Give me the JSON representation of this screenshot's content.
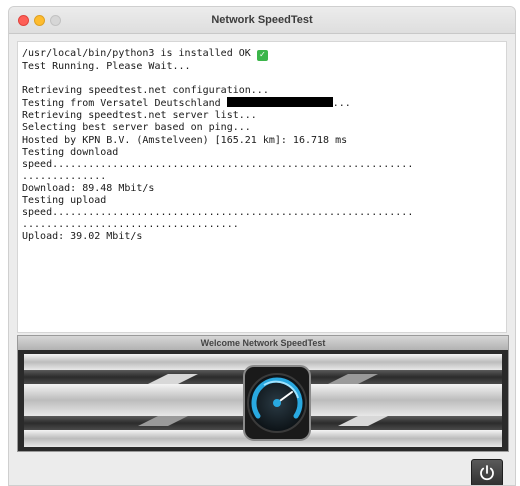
{
  "window": {
    "title": "Network SpeedTest"
  },
  "console": {
    "install_line": "/usr/local/bin/python3 is installed OK",
    "running_line": "Test Running. Please Wait...",
    "config_line": "Retrieving speedtest.net configuration...",
    "testing_from_prefix": "Testing from Versatel Deutschland",
    "testing_from_suffix": "...",
    "server_list_line": "Retrieving speedtest.net server list...",
    "selecting_line": "Selecting best server based on ping...",
    "hosted_line": "Hosted by KPN B.V. (Amstelveen) [165.21 km]: 16.718 ms",
    "testing_download": "Testing download",
    "speed_dl_1": "speed............................................................",
    "speed_dl_2": "..............",
    "download_result": "Download: 89.48 Mbit/s",
    "testing_upload": "Testing upload",
    "speed_ul_1": "speed............................................................",
    "speed_ul_2": "....................................",
    "upload_result": "Upload: 39.02 Mbit/s"
  },
  "banner": {
    "title": "Welcome Network SpeedTest"
  },
  "icons": {
    "ok": "check-mark-icon",
    "gauge": "speedometer-icon",
    "power": "power-icon"
  },
  "colors": {
    "ok_green": "#3bb54a",
    "gauge_accent": "#29a9e1",
    "traffic_close": "#fe5f57",
    "traffic_minimize": "#febc2e"
  }
}
